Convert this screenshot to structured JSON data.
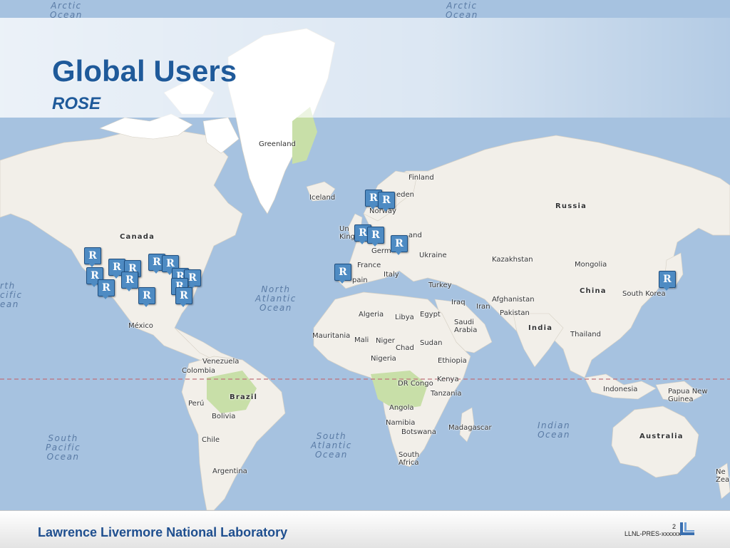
{
  "slide": {
    "title": "Global Users",
    "subtitle": "ROSE",
    "footer_org": "Lawrence Livermore National Laboratory",
    "page_number": "2",
    "doc_code": "LLNL-PRES-xxxxxx"
  },
  "map": {
    "marker_glyph": "R",
    "marker_color": "#4e8bc3",
    "ocean_color": "#a6c2e0",
    "land_color": "#f2efe9",
    "ice_color": "#ffffff",
    "vegetation_color": "#c8dfa8",
    "equator_color": "#c0707a",
    "labels": {
      "arctic_w": "Arctic\nOcean",
      "arctic_e": "Arctic\nOcean",
      "greenland": "Greenland",
      "iceland": "Iceland",
      "finland": "Finland",
      "sweden": "eden",
      "norway": "Norway",
      "russia": "Russia",
      "canada": "Canada",
      "uk": "Un\nKing",
      "poland": "and",
      "germany": "Germ",
      "ukraine": "Ukraine",
      "france": "France",
      "spain": "pain",
      "italy": "Italy",
      "turkey": "Turkey",
      "kazakhstan": "Kazakhstan",
      "mongolia": "Mongolia",
      "china": "China",
      "south_korea": "South Korea",
      "afghanistan": "Afghanistan",
      "iraq": "Iraq",
      "iran": "Iran",
      "pakistan": "Pakistan",
      "india": "India",
      "thailand": "Thailand",
      "algeria": "Algeria",
      "libya": "Libya",
      "egypt": "Egypt",
      "saudi": "Saudi\nArabia",
      "mauritania": "Mauritania",
      "mali": "Mali",
      "niger": "Niger",
      "chad": "Chad",
      "sudan": "Sudan",
      "ethiopia": "Ethiopia",
      "nigeria": "Nigeria",
      "kenya": "Kenya",
      "drc": "DR Congo",
      "tanzania": "Tanzania",
      "angola": "Angola",
      "namibia": "Namibia",
      "botswana": "Botswana",
      "madagascar": "Madagascar",
      "south_africa": "South\nAfrica",
      "mexico": "México",
      "venezuela": "Venezuela",
      "colombia": "Colombia",
      "brazil": "Brazil",
      "peru": "Perú",
      "bolivia": "Bolivia",
      "chile": "Chile",
      "argentina": "Argentina",
      "indonesia": "Indonesia",
      "papua": "Papua New\nGuinea",
      "australia": "Australia",
      "new_zealand": "Ne\nZeal",
      "n_atlantic": "North\nAtlantic\nOcean",
      "s_atlantic": "South\nAtlantic\nOcean",
      "s_pacific": "South\nPacific\nOcean",
      "indian": "Indian\nOcean",
      "pacific_w": "rth\ncific\nean"
    }
  }
}
